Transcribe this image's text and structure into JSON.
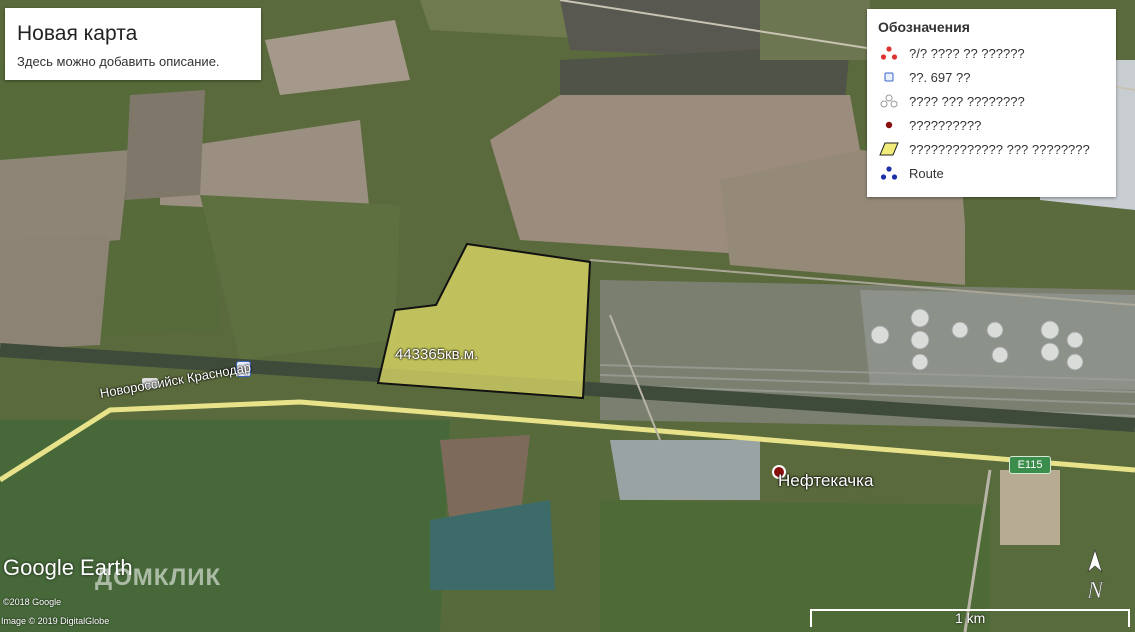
{
  "map": {
    "title": "Новая карта",
    "description": "Здесь можно добавить описание.",
    "area_label": "443365кв.м.",
    "road_label": "Новороссийск Краснодар",
    "town_label": "Нефтекачка",
    "highway_shield": "E115",
    "area_color": "#e8e36a",
    "road_color": "#f0e88a"
  },
  "legend": {
    "heading": "Обозначения",
    "items": [
      {
        "icon": "red-triangle-markers-icon",
        "label": "?/? ???? ?? ??????"
      },
      {
        "icon": "blue-square-icon",
        "label": "??. 697 ??"
      },
      {
        "icon": "grey-circles-icon",
        "label": "???? ??? ????????"
      },
      {
        "icon": "red-dot-icon",
        "label": "??????????"
      },
      {
        "icon": "yellow-polygon-icon",
        "label": "????????????? ??? ????????"
      },
      {
        "icon": "blue-route-markers-icon",
        "label": "Route"
      }
    ]
  },
  "branding": {
    "google_earth": "Google Earth",
    "watermark": "ДОМКЛИК",
    "copyright_1": "©2018 Google",
    "copyright_2": "Image © 2019 DigitalGlobe"
  },
  "scale": {
    "label": "1 km"
  },
  "compass": {
    "label": "N"
  }
}
